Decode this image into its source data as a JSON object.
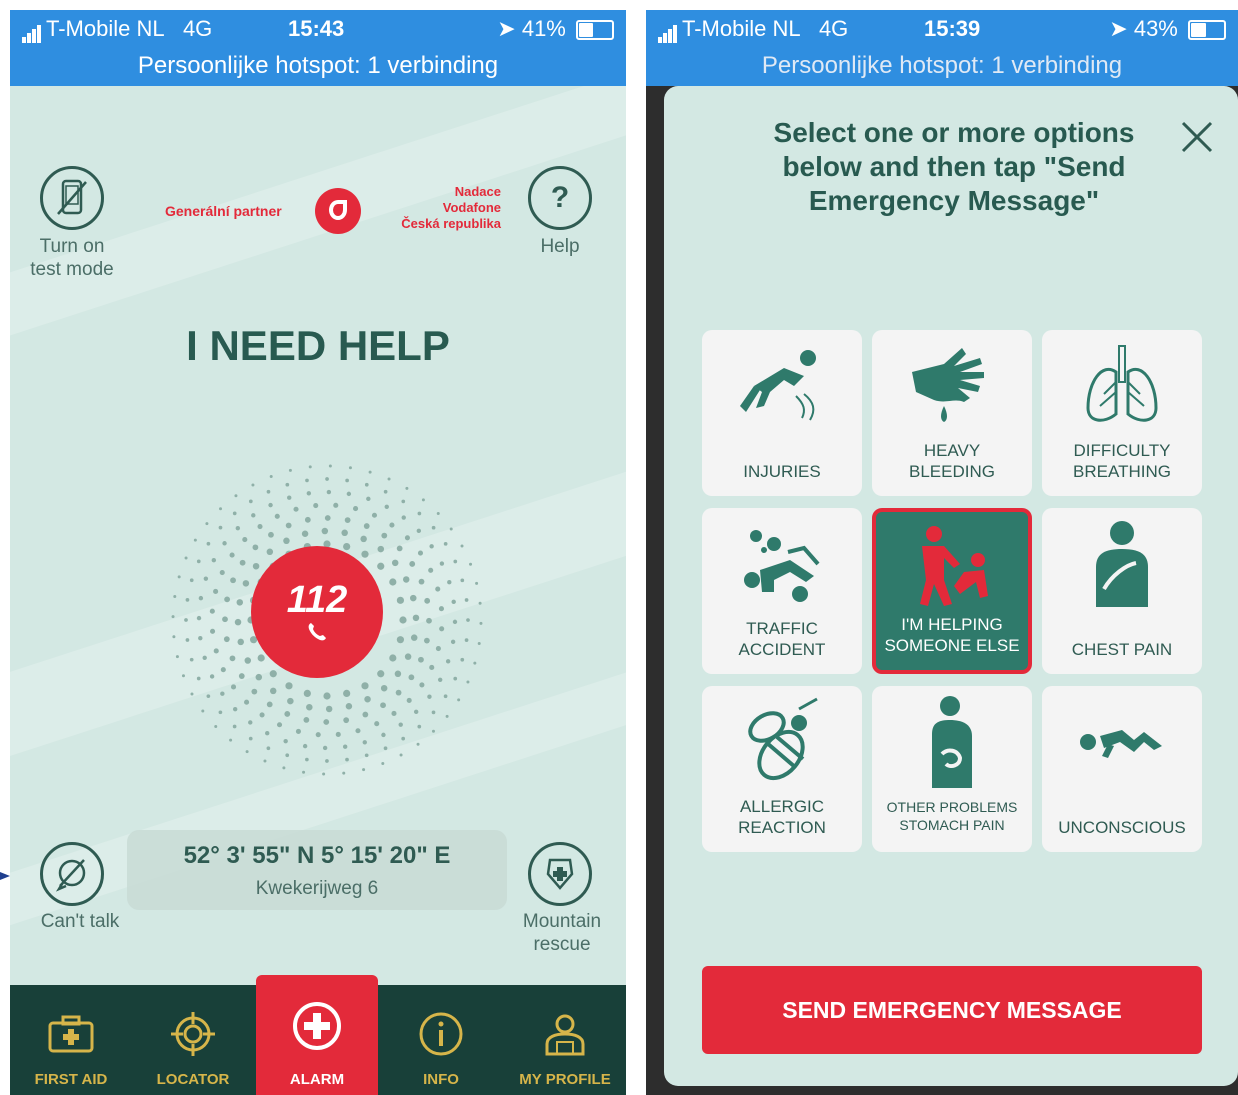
{
  "left_screen": {
    "status": {
      "carrier": "T-Mobile NL",
      "network": "4G",
      "time": "15:43",
      "battery": "41%",
      "battery_level": 0.41,
      "hotspot": "Persoonlijke hotspot: 1 verbinding"
    },
    "test_mode_label": "Turn on\ntest mode",
    "help_label": "Help",
    "help_glyph": "?",
    "sponsor": {
      "partner_text": "Generální partner",
      "foundation_text": "Nadace\nVodafone\nČeská republika"
    },
    "headline": "I NEED HELP",
    "emergency_number": "112",
    "location": {
      "coords": "52° 3' 55\" N 5° 15' 20\" E",
      "address": "Kwekerijweg 6"
    },
    "cant_talk_label": "Can't talk",
    "mountain_label": "Mountain\nrescue",
    "tabs": [
      {
        "label": "FIRST AID",
        "icon": "first-aid-kit-icon"
      },
      {
        "label": "LOCATOR",
        "icon": "crosshair-icon"
      },
      {
        "label": "ALARM",
        "icon": "plus-circle-icon",
        "active": true
      },
      {
        "label": "INFO",
        "icon": "info-icon"
      },
      {
        "label": "MY PROFILE",
        "icon": "profile-icon"
      }
    ],
    "colors": {
      "accent": "#e32a3a",
      "dark_green": "#184039",
      "text_green": "#285a50",
      "tab_gold": "#d6b54a"
    }
  },
  "right_screen": {
    "status": {
      "carrier": "T-Mobile NL",
      "network": "4G",
      "time": "15:39",
      "battery": "43%",
      "battery_level": 0.43,
      "hotspot": "Persoonlijke hotspot: 1 verbinding"
    },
    "title": "Select one or more options below and then tap \"Send Emergency Message\"",
    "options": [
      {
        "label": "INJURIES",
        "icon": "falling-person-icon",
        "selected": false
      },
      {
        "label": "HEAVY\nBLEEDING",
        "icon": "bleeding-hand-icon",
        "selected": false
      },
      {
        "label": "DIFFICULTY\nBREATHING",
        "icon": "lungs-icon",
        "selected": false
      },
      {
        "label": "TRAFFIC\nACCIDENT",
        "icon": "traffic-accident-icon",
        "selected": false
      },
      {
        "label": "I'M HELPING\nSOMEONE ELSE",
        "icon": "helping-person-icon",
        "selected": true
      },
      {
        "label": "CHEST PAIN",
        "icon": "chest-pain-icon",
        "selected": false
      },
      {
        "label": "ALLERGIC\nREACTION",
        "icon": "bee-icon",
        "selected": false
      },
      {
        "label": "OTHER PROBLEMS\nSTOMACH PAIN",
        "icon": "stomach-pain-icon",
        "selected": false
      },
      {
        "label": "UNCONSCIOUS",
        "icon": "unconscious-person-icon",
        "selected": false
      }
    ],
    "send_button": "SEND EMERGENCY MESSAGE"
  }
}
